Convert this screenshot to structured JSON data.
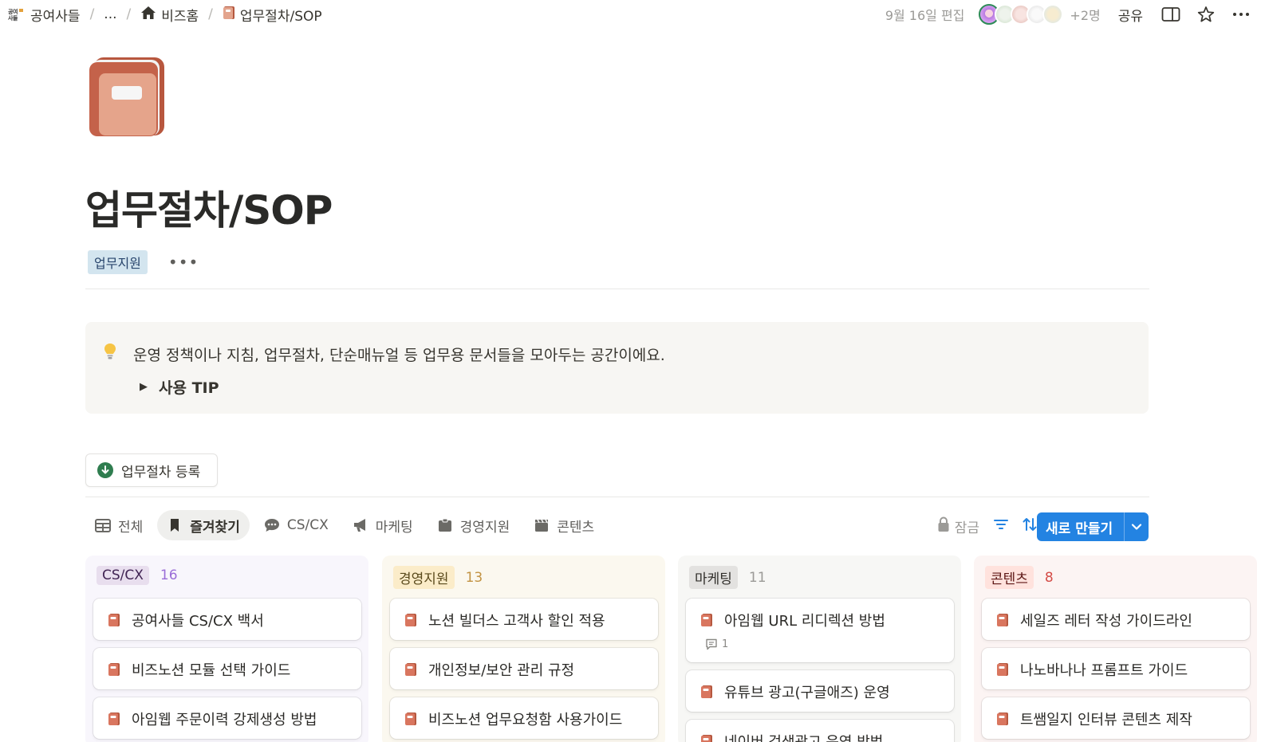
{
  "breadcrumb": {
    "workspace_logo_text": "공여\n사들",
    "workspace": "공여사들",
    "ellipsis": "...",
    "parent": "비즈홈",
    "current": "업무절차/SOP"
  },
  "topbar": {
    "edited": "9월 16일 편집",
    "more_people": "+2명",
    "share": "공유"
  },
  "page": {
    "title": "업무절차/SOP",
    "tag": "업무지원",
    "tag_more": "•••"
  },
  "callout": {
    "text": "운영 정책이나 지침, 업무절차, 단순매뉴얼 등 업무용 문서들을 모아두는 공간이에요.",
    "toggle_label": "사용 TIP"
  },
  "register_button": "업무절차 등록",
  "tabs": [
    {
      "label": "전체",
      "icon": "table-icon"
    },
    {
      "label": "즐겨찾기",
      "icon": "bookmark-icon"
    },
    {
      "label": "CS/CX",
      "icon": "chat-icon"
    },
    {
      "label": "마케팅",
      "icon": "megaphone-icon"
    },
    {
      "label": "경영지원",
      "icon": "clipboard-icon"
    },
    {
      "label": "콘텐츠",
      "icon": "clapper-icon"
    }
  ],
  "toolbar": {
    "lock": "잠금",
    "new": "새로 만들기"
  },
  "colors": {
    "accent": "#2383e2",
    "doc_icon": "#d9765f"
  },
  "board": {
    "columns": [
      {
        "name": "CS/CX",
        "count": "16",
        "bg": "#f8f6fc",
        "badge_bg": "#e8deee",
        "badge_fg": "#412454",
        "count_fg": "#9a6dd7",
        "cards": [
          {
            "title": "공여사들 CS/CX 백서"
          },
          {
            "title": "비즈노션 모듈 선택 가이드"
          },
          {
            "title": "아임웹 주문이력 강제생성 방법"
          }
        ]
      },
      {
        "name": "경영지원",
        "count": "13",
        "bg": "#fbf8ef",
        "badge_bg": "#fbecc9",
        "badge_fg": "#5a4a1c",
        "count_fg": "#c29343",
        "cards": [
          {
            "title": "노션 빌더스 고객사 할인 적용"
          },
          {
            "title": "개인정보/보안 관리 규정"
          },
          {
            "title": "비즈노션 업무요청함 사용가이드"
          }
        ]
      },
      {
        "name": "마케팅",
        "count": "11",
        "bg": "#f7f7f5",
        "badge_bg": "#e3e2e0",
        "badge_fg": "#32302c",
        "count_fg": "#9b9a97",
        "cards": [
          {
            "title": "아임웹 URL 리디렉션 방법",
            "comments": "1"
          },
          {
            "title": "유튜브 광고(구글애즈) 운영"
          },
          {
            "title": "네이버 검색광고 운영 방법"
          }
        ]
      },
      {
        "name": "콘텐츠",
        "count": "8",
        "bg": "#fcf4f3",
        "badge_bg": "#ffe2dd",
        "badge_fg": "#5d1715",
        "count_fg": "#d44c47",
        "cards": [
          {
            "title": "세일즈 레터 작성 가이드라인"
          },
          {
            "title": "나노바나나 프롬프트 가이드"
          },
          {
            "title": "트쌤일지 인터뷰 콘텐츠 제작"
          }
        ]
      }
    ]
  }
}
